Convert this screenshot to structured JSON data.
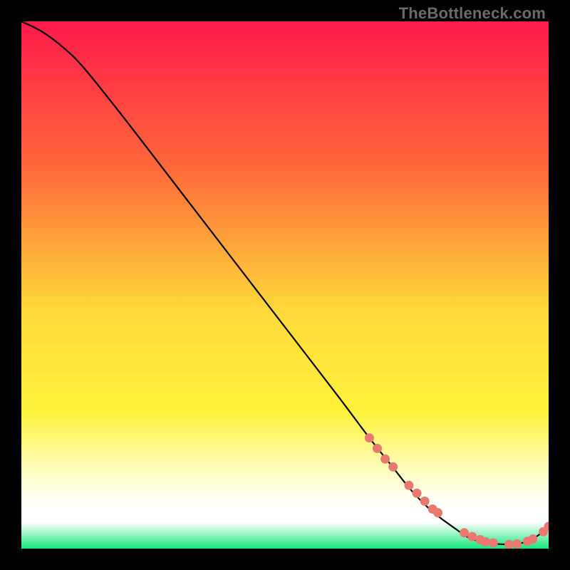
{
  "watermark": "TheBottleneck.com",
  "colors": {
    "bg": "#000000",
    "grad_top": "#ff1a4b",
    "grad_mid1": "#ff6a3a",
    "grad_mid2": "#ffd93a",
    "grad_yellow": "#fff23a",
    "grad_pale": "#fdffc8",
    "grad_white": "#ffffff",
    "grad_green": "#17e87a",
    "line": "#000000",
    "marker_fill": "#e9786e",
    "marker_stroke": "#c95a50"
  },
  "chart_data": {
    "type": "line",
    "title": "",
    "xlabel": "",
    "ylabel": "",
    "xlim": [
      0,
      100
    ],
    "ylim": [
      0,
      100
    ],
    "series": [
      {
        "name": "bottleneck-curve",
        "x": [
          0,
          4,
          8,
          12,
          20,
          30,
          40,
          50,
          60,
          66,
          70,
          74,
          78,
          82,
          85,
          88,
          90,
          92,
          94,
          96,
          98,
          100
        ],
        "y": [
          100,
          98,
          95,
          91,
          81,
          68,
          55,
          42,
          29,
          21,
          16,
          11,
          7,
          4,
          2,
          1.2,
          0.9,
          0.8,
          0.9,
          1.4,
          2.5,
          4.2
        ]
      }
    ],
    "markers": {
      "name": "highlight-points",
      "x": [
        66,
        67.5,
        69,
        70.5,
        73.5,
        75,
        76.5,
        78,
        79,
        84,
        85.5,
        87,
        88,
        89.5,
        92.5,
        94,
        96,
        97,
        99,
        100
      ],
      "y": [
        21,
        19,
        17,
        15.5,
        12,
        10.5,
        9,
        7.5,
        6.8,
        3,
        2.3,
        1.7,
        1.3,
        1.1,
        0.8,
        0.9,
        1.4,
        1.8,
        3.2,
        4.2
      ]
    }
  }
}
